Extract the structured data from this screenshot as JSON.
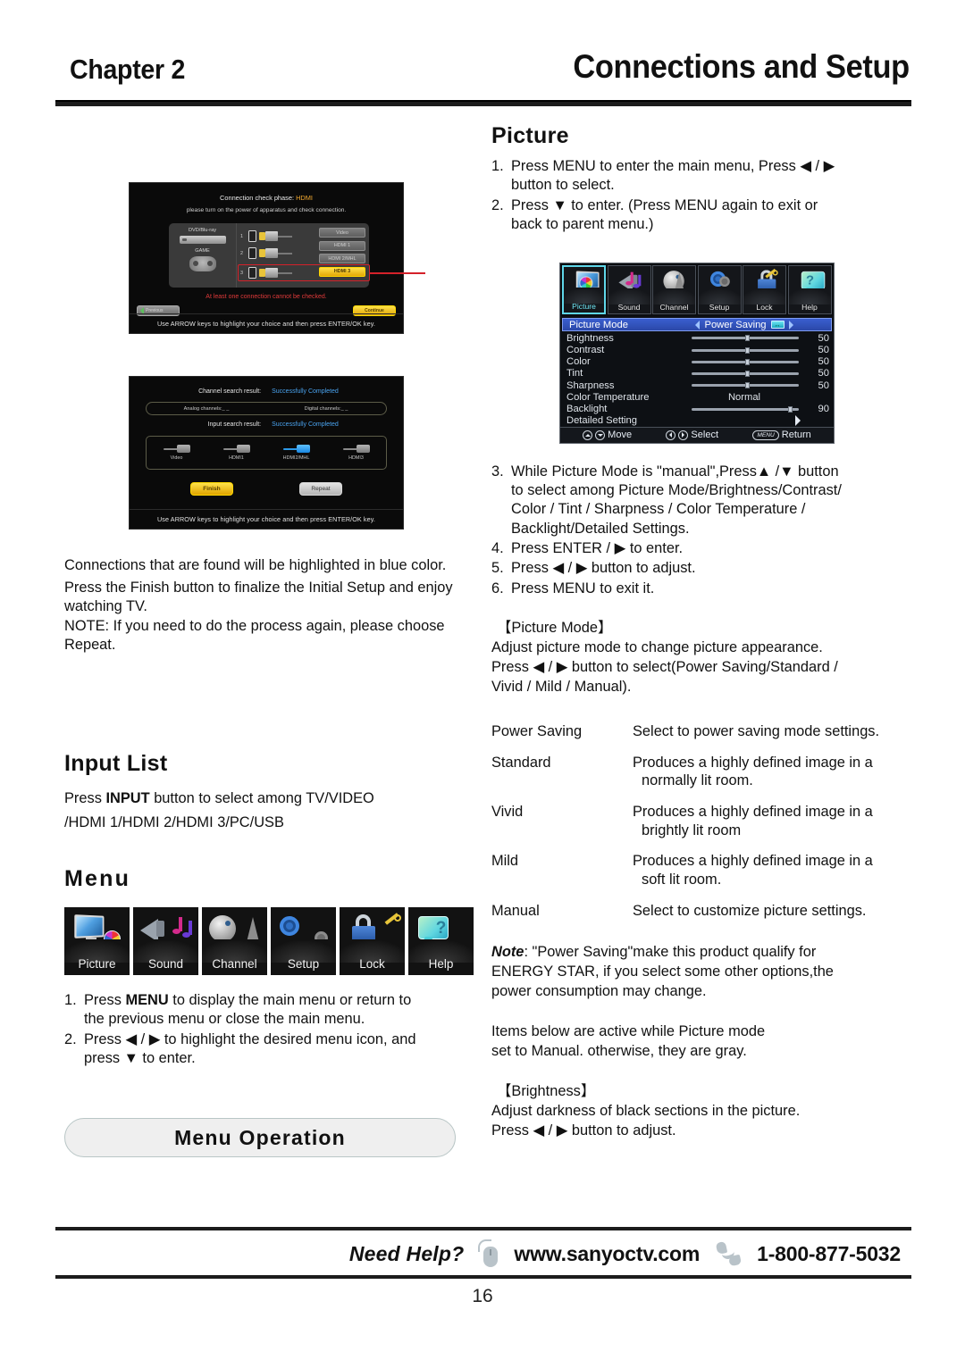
{
  "header": {
    "chapter": "Chapter 2",
    "title": "Connections and Setup"
  },
  "left_column": {
    "screen1": {
      "line1_prefix": "Connection check phase:",
      "line1_value": "HDMI",
      "line2": "please turn on the power of apparatus and check connection.",
      "devices": [
        "DVD/Blu-ray",
        "GAME"
      ],
      "port_numbers": [
        "1",
        "2",
        "3"
      ],
      "input_buttons": [
        "Video",
        "HDMI 1",
        "HDMI 2/MHL",
        "HDMI 3"
      ],
      "selected_input": "HDMI 3",
      "warning": "At least one connection cannot be checked.",
      "prev_button": "Previous",
      "continue_button": "Continue",
      "hint": "Use ARROW keys to highlight your choice and then press ENTER/OK key."
    },
    "screen2": {
      "channel_result_label": "Channel search result:",
      "channel_result_value": "Successfully Completed",
      "analog_label": "Analog channels:_ _",
      "digital_label": "Digital channels:_ _",
      "input_result_label": "Input search result:",
      "input_result_value": "Successfully Completed",
      "inputs": [
        "Video",
        "HDMI1",
        "HDMI2/MHL",
        "HDMI3"
      ],
      "active_input": "HDMI2/MHL",
      "finish_button": "Finish",
      "repeat_button": "Repeat",
      "hint": "Use ARROW keys to highlight your choice and then press ENTER/OK key."
    },
    "paragraphs": [
      "Connections that are found will be highlighted in blue color.",
      "Press the Finish button to finalize the Initial Setup and enjoy watching TV.",
      "NOTE: If you need to do the process again, please choose Repeat."
    ],
    "input_list": {
      "heading": "Input List",
      "line1_a": "Press ",
      "line1_b": "INPUT",
      "line1_c": " button to select among TV/VIDEO",
      "line2": "/HDMI 1/HDMI 2/HDMI 3/PC/USB"
    },
    "menu": {
      "heading": "Menu",
      "icons": [
        {
          "label": "Picture",
          "icon": "picture-icon"
        },
        {
          "label": "Sound",
          "icon": "sound-icon"
        },
        {
          "label": "Channel",
          "icon": "channel-icon"
        },
        {
          "label": "Setup",
          "icon": "setup-icon"
        },
        {
          "label": "Lock",
          "icon": "lock-icon"
        },
        {
          "label": "Help",
          "icon": "help-icon"
        }
      ],
      "steps": [
        {
          "n": "1.",
          "a": "Press ",
          "b": "MENU",
          "c": " to display the main menu or return to",
          "cont": "the previous menu or close the main menu."
        },
        {
          "n": "2.",
          "a": "Press ",
          "b": "◀ / ▶",
          "c": " to highlight the desired menu icon, and",
          "cont": "press ▼ to enter."
        }
      ],
      "operation_pill": "Menu Operation"
    }
  },
  "right_column": {
    "picture": {
      "heading": "Picture",
      "steps": [
        {
          "n": "1.",
          "line1": "Press MENU to enter the main menu, Press ◀ / ▶",
          "line2": "button to select."
        },
        {
          "n": "2.",
          "line1": "Press ▼ to enter. (Press MENU again to exit or",
          "line2": "back to parent menu.)"
        }
      ]
    },
    "osd": {
      "tabs": [
        {
          "label": "Picture",
          "icon": "picture-icon",
          "selected": true
        },
        {
          "label": "Sound",
          "icon": "sound-icon",
          "selected": false
        },
        {
          "label": "Channel",
          "icon": "channel-icon",
          "selected": false
        },
        {
          "label": "Setup",
          "icon": "setup-icon",
          "selected": false
        },
        {
          "label": "Lock",
          "icon": "lock-icon",
          "selected": false
        },
        {
          "label": "Help",
          "icon": "help-icon",
          "selected": false
        }
      ],
      "rows": [
        {
          "label": "Picture Mode",
          "value": "Power Saving",
          "type": "selector",
          "highlighted": true
        },
        {
          "label": "Brightness",
          "value": "50",
          "type": "slider",
          "pct": 50
        },
        {
          "label": "Contrast",
          "value": "50",
          "type": "slider",
          "pct": 50
        },
        {
          "label": "Color",
          "value": "50",
          "type": "slider",
          "pct": 50
        },
        {
          "label": "Tint",
          "value": "50",
          "type": "slider",
          "pct": 50
        },
        {
          "label": "Sharpness",
          "value": "50",
          "type": "slider",
          "pct": 50
        },
        {
          "label": "Color Temperature",
          "value": "Normal",
          "type": "text"
        },
        {
          "label": "Backlight",
          "value": "90",
          "type": "slider",
          "pct": 90
        },
        {
          "label": "Detailed Setting",
          "value": "",
          "type": "submenu"
        }
      ],
      "footer": [
        {
          "keys": "▲▼",
          "label": "Move"
        },
        {
          "keys": "◀▶",
          "label": "Select"
        },
        {
          "keys": "MENU",
          "label": "Return"
        }
      ]
    },
    "steps_3_6": [
      {
        "n": "3.",
        "lines": [
          "While Picture Mode is \"manual\",Press▲ /▼  button",
          "to select among Picture Mode/Brightness/Contrast/",
          "Color / Tint / Sharpness / Color Temperature /",
          "Backlight/Detailed Settings."
        ]
      },
      {
        "n": "4.",
        "lines": [
          "Press ENTER / ▶ to enter."
        ],
        "bold": "ENTER"
      },
      {
        "n": "5.",
        "lines": [
          "Press ◀ / ▶  button to adjust."
        ]
      },
      {
        "n": "6.",
        "lines": [
          "Press MENU to exit it."
        ]
      }
    ],
    "picture_mode_block": {
      "title": "【Picture Mode】",
      "lines": [
        "Adjust picture mode to change picture appearance.",
        "Press ◀ / ▶ button to select(Power Saving/Standard /",
        "Vivid / Mild / Manual)."
      ]
    },
    "modes": [
      {
        "name": "Power Saving",
        "desc": "Select to power saving mode settings.",
        "cont": ""
      },
      {
        "name": "Standard",
        "desc": "Produces a highly defined image in a",
        "cont": "normally lit room."
      },
      {
        "name": "Vivid",
        "desc": "Produces a highly defined image in a",
        "cont": "brightly lit room"
      },
      {
        "name": "Mild",
        "desc": "Produces a highly defined image in a",
        "cont": "soft lit room."
      },
      {
        "name": "Manual",
        "desc": "Select to customize picture settings.",
        "cont": ""
      }
    ],
    "note": {
      "label": "Note",
      "lines": [
        ": \"Power Saving\"make this product qualify for",
        "ENERGY STAR, if you select some other options,the",
        "power consumption may change."
      ]
    },
    "items_below": [
      "Items below are  active while Picture mode",
      "set to Manual. otherwise, they are gray."
    ],
    "brightness_block": {
      "title": "【Brightness】",
      "lines": [
        "Adjust darkness of black sections in the picture.",
        "Press ◀ / ▶ button to adjust."
      ]
    }
  },
  "footer": {
    "need_help": "Need Help?",
    "website": "www.sanyoctv.com",
    "phone": "1-800-877-5032",
    "page_number": "16"
  }
}
